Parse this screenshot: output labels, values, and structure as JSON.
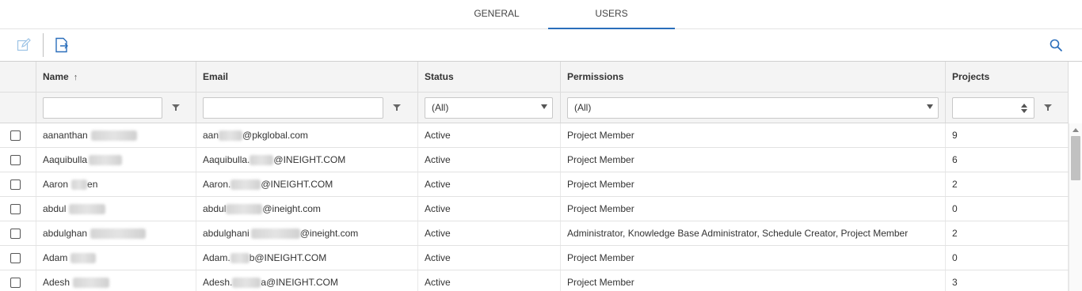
{
  "tabs": {
    "general": "GENERAL",
    "users": "USERS"
  },
  "toolbar": {
    "edit_icon": "edit-icon",
    "export_icon": "export-icon",
    "search_icon": "search-icon"
  },
  "columns": {
    "name": "Name",
    "email": "Email",
    "status": "Status",
    "permissions": "Permissions",
    "projects": "Projects"
  },
  "sort": {
    "column": "Name",
    "direction": "↑"
  },
  "filters": {
    "name": "",
    "email": "",
    "status": "(All)",
    "permissions": "(All)",
    "projects": ""
  },
  "rows": [
    {
      "name": "aananthan",
      "email_prefix": "aan",
      "email_suffix": "@pkglobal.com",
      "status": "Active",
      "permissions": "Project Member",
      "projects": "9"
    },
    {
      "name": "Aaquibulla",
      "email_prefix": "Aaquibulla.",
      "email_suffix": "@INEIGHT.COM",
      "status": "Active",
      "permissions": "Project Member",
      "projects": "6"
    },
    {
      "name": "Aaron",
      "name_tail": "en",
      "email_prefix": "Aaron.",
      "email_suffix": "@INEIGHT.COM",
      "status": "Active",
      "permissions": "Project Member",
      "projects": "2"
    },
    {
      "name": "abdul",
      "email_prefix": "abdul",
      "email_suffix": "@ineight.com",
      "status": "Active",
      "permissions": "Project Member",
      "projects": "0"
    },
    {
      "name": "abdulghan",
      "email_prefix": "abdulghani",
      "email_suffix": "@ineight.com",
      "status": "Active",
      "permissions": "Administrator, Knowledge Base Administrator, Schedule Creator, Project Member",
      "projects": "2"
    },
    {
      "name": "Adam",
      "email_prefix": "Adam.",
      "email_suffix": "b@INEIGHT.COM",
      "status": "Active",
      "permissions": "Project Member",
      "projects": "0"
    },
    {
      "name": "Adesh",
      "email_prefix": "Adesh.",
      "email_suffix": "a@INEIGHT.COM",
      "status": "Active",
      "permissions": "Project Member",
      "projects": "3"
    }
  ],
  "colors": {
    "accent": "#2a6ebb",
    "icon": "#2a6ebb"
  }
}
